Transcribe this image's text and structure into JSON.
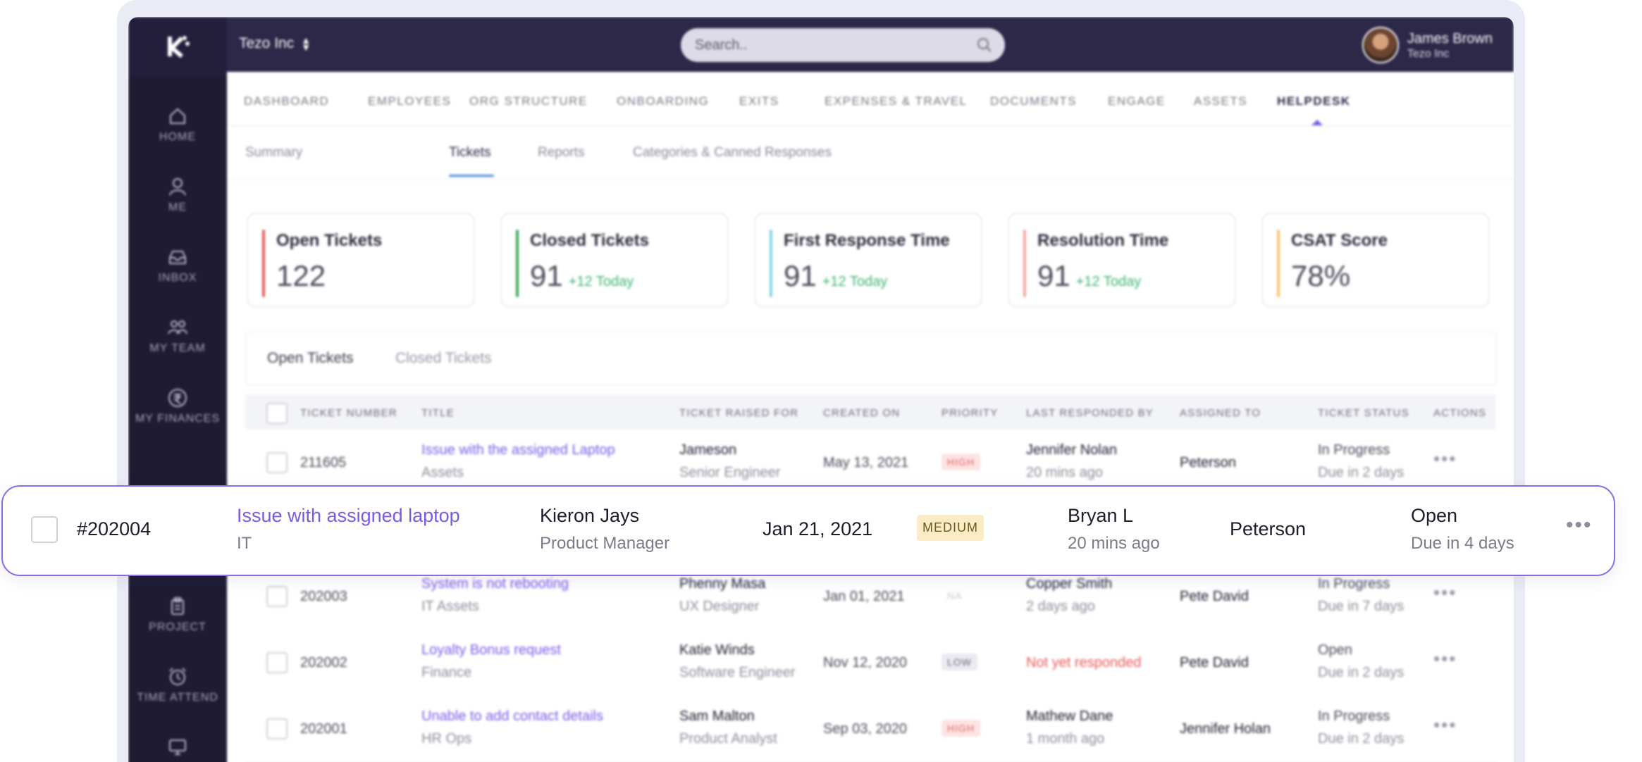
{
  "topbar": {
    "company": "Tezo Inc",
    "search_placeholder": "Search..",
    "user_name": "James Brown",
    "user_org": "Tezo Inc"
  },
  "sidebar": {
    "items": [
      {
        "label": "HOME",
        "icon": "home-icon"
      },
      {
        "label": "ME",
        "icon": "user-icon"
      },
      {
        "label": "INBOX",
        "icon": "inbox-icon"
      },
      {
        "label": "MY TEAM",
        "icon": "team-icon"
      },
      {
        "label": "MY FINANCES",
        "icon": "rupee-icon"
      },
      {
        "label": "",
        "icon": "building-icon"
      },
      {
        "label": "PROJECT",
        "icon": "clipboard-icon"
      },
      {
        "label": "TIME ATTEND",
        "icon": "alarm-icon"
      },
      {
        "label": "",
        "icon": "monitor-icon"
      }
    ]
  },
  "nav": {
    "tabs": [
      "DASHBOARD",
      "EMPLOYEES",
      "ORG STRUCTURE",
      "ONBOARDING",
      "EXITS",
      "EXPENSES & TRAVEL",
      "DOCUMENTS",
      "ENGAGE",
      "ASSETS",
      "HELPDESK"
    ],
    "active": "HELPDESK"
  },
  "subnav": {
    "tabs": [
      "Summary",
      "Tickets",
      "Reports",
      "Categories & Canned Responses"
    ],
    "active": "Tickets"
  },
  "cards": [
    {
      "title": "Open Tickets",
      "value": "122",
      "delta": "",
      "color": "#e25c5c"
    },
    {
      "title": "Closed Tickets",
      "value": "91",
      "delta": "+12 Today",
      "color": "#3aa757"
    },
    {
      "title": "First Response Time",
      "value": "91",
      "delta": "+12 Today",
      "color": "#7ed3ea"
    },
    {
      "title": "Resolution Time",
      "value": "91",
      "delta": "+12 Today",
      "color": "#f2a5a5"
    },
    {
      "title": "CSAT Score",
      "value": "78%",
      "delta": "",
      "color": "#f5c46b"
    }
  ],
  "ticket_tabs": [
    "Open Tickets",
    "Closed Tickets"
  ],
  "table": {
    "headers": [
      "TICKET NUMBER",
      "TITLE",
      "TICKET RAISED FOR",
      "CREATED ON",
      "PRIORITY",
      "LAST RESPONDED BY",
      "ASSIGNED TO",
      "TICKET STATUS",
      "ACTIONS"
    ],
    "rows": [
      {
        "number": "211605",
        "title": "Issue with the assigned Laptop",
        "category": "Assets",
        "raised_for": "Jameson",
        "role": "Senior Engineer",
        "created": "May 13, 2021",
        "priority": "HIGH",
        "responder": "Jennifer Nolan",
        "responded": "20 mins ago",
        "assigned": "Peterson",
        "status": "In Progress",
        "due": "Due in 2 days"
      },
      {
        "number": "202003",
        "title": "System is not rebooting",
        "category": "IT Assets",
        "raised_for": "Phenny Masa",
        "role": "UX Designer",
        "created": "Jan 01, 2021",
        "priority": "NA",
        "responder": "Copper Smith",
        "responded": "2 days ago",
        "assigned": "Pete David",
        "status": "In Progress",
        "due": "Due in 7 days"
      },
      {
        "number": "202002",
        "title": "Loyalty Bonus request",
        "category": "Finance",
        "raised_for": "Katie Winds",
        "role": "Software Engineer",
        "created": "Nov 12, 2020",
        "priority": "LOW",
        "responder": "Not yet responded",
        "responded": "",
        "assigned": "Pete David",
        "status": "Open",
        "due": "Due in 2 days"
      },
      {
        "number": "202001",
        "title": "Unable to add contact details",
        "category": "HR Ops",
        "raised_for": "Sam Malton",
        "role": "Product Analyst",
        "created": "Sep 03, 2020",
        "priority": "HIGH",
        "responder": "Mathew Dane",
        "responded": "1 month ago",
        "assigned": "Jennifer Holan",
        "status": "In Progress",
        "due": "Due in 2 days"
      }
    ]
  },
  "focus_row": {
    "number": "#202004",
    "title": "Issue with assigned laptop",
    "category": "IT",
    "raised_for": "Kieron Jays",
    "role": "Product Manager",
    "created": "Jan 21, 2021",
    "priority": "MEDIUM",
    "responder": "Bryan L",
    "responded": "20 mins ago",
    "assigned": "Peterson",
    "status": "Open",
    "due": "Due in 4 days"
  }
}
